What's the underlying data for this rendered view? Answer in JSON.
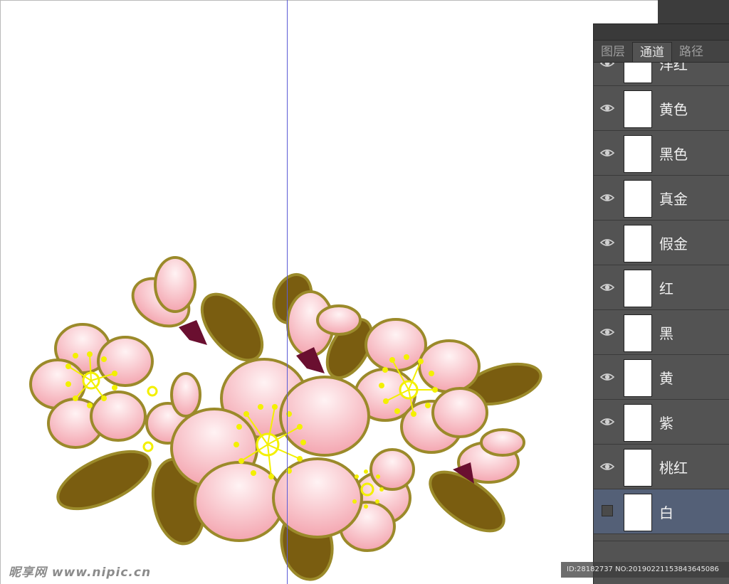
{
  "panel": {
    "tabs": [
      {
        "label": "图层",
        "active": false
      },
      {
        "label": "通道",
        "active": true
      },
      {
        "label": "路径",
        "active": false
      }
    ],
    "channels": [
      {
        "label": "洋红",
        "visible": true,
        "selected": false
      },
      {
        "label": "黄色",
        "visible": true,
        "selected": false
      },
      {
        "label": "黑色",
        "visible": true,
        "selected": false
      },
      {
        "label": "真金",
        "visible": true,
        "selected": false
      },
      {
        "label": "假金",
        "visible": true,
        "selected": false
      },
      {
        "label": "红",
        "visible": true,
        "selected": false
      },
      {
        "label": "黑",
        "visible": true,
        "selected": false
      },
      {
        "label": "黄",
        "visible": true,
        "selected": false
      },
      {
        "label": "紫",
        "visible": true,
        "selected": false
      },
      {
        "label": "桃红",
        "visible": true,
        "selected": false
      },
      {
        "label": "白",
        "visible": false,
        "selected": true
      }
    ]
  },
  "watermark": {
    "left": "昵享网 www.nipic.cn",
    "right": "ID:28182737 NO:20190221153843645086"
  },
  "colors": {
    "petal_light": "#fdeff0",
    "petal_dark": "#f3a6b0",
    "outline": "#9b8a2a",
    "leaf": "#7a5d10",
    "stamen": "#f3f000",
    "calyx": "#6a0f30",
    "guide": "#5b5bd6"
  }
}
